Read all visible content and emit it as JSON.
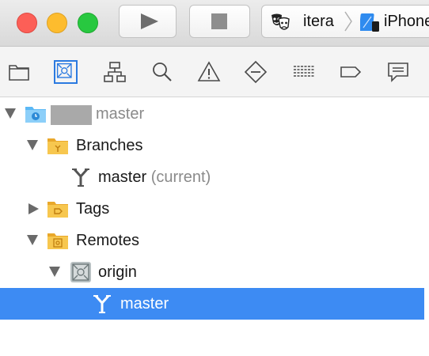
{
  "toolbar": {
    "scheme_name": "itera",
    "device_name": "iPhone"
  },
  "navigator": {
    "tabs": [
      {
        "icon": "folder-icon"
      },
      {
        "icon": "source-control-icon",
        "selected": true
      },
      {
        "icon": "hierarchy-icon"
      },
      {
        "icon": "search-icon"
      },
      {
        "icon": "warning-icon"
      },
      {
        "icon": "test-icon"
      },
      {
        "icon": "debug-list-icon"
      },
      {
        "icon": "breakpoint-icon"
      },
      {
        "icon": "report-icon"
      }
    ]
  },
  "tree": {
    "repo": {
      "branch": "master"
    },
    "branches": {
      "label": "Branches"
    },
    "current_branch": {
      "label": "master",
      "suffix": "(current)"
    },
    "tags": {
      "label": "Tags"
    },
    "remotes": {
      "label": "Remotes"
    },
    "origin": {
      "label": "origin"
    },
    "remote_branch": {
      "label": "master"
    }
  },
  "colors": {
    "selection": "#3d8bf3",
    "folder": "#f7c34a",
    "accent": "#2b7ae0"
  }
}
